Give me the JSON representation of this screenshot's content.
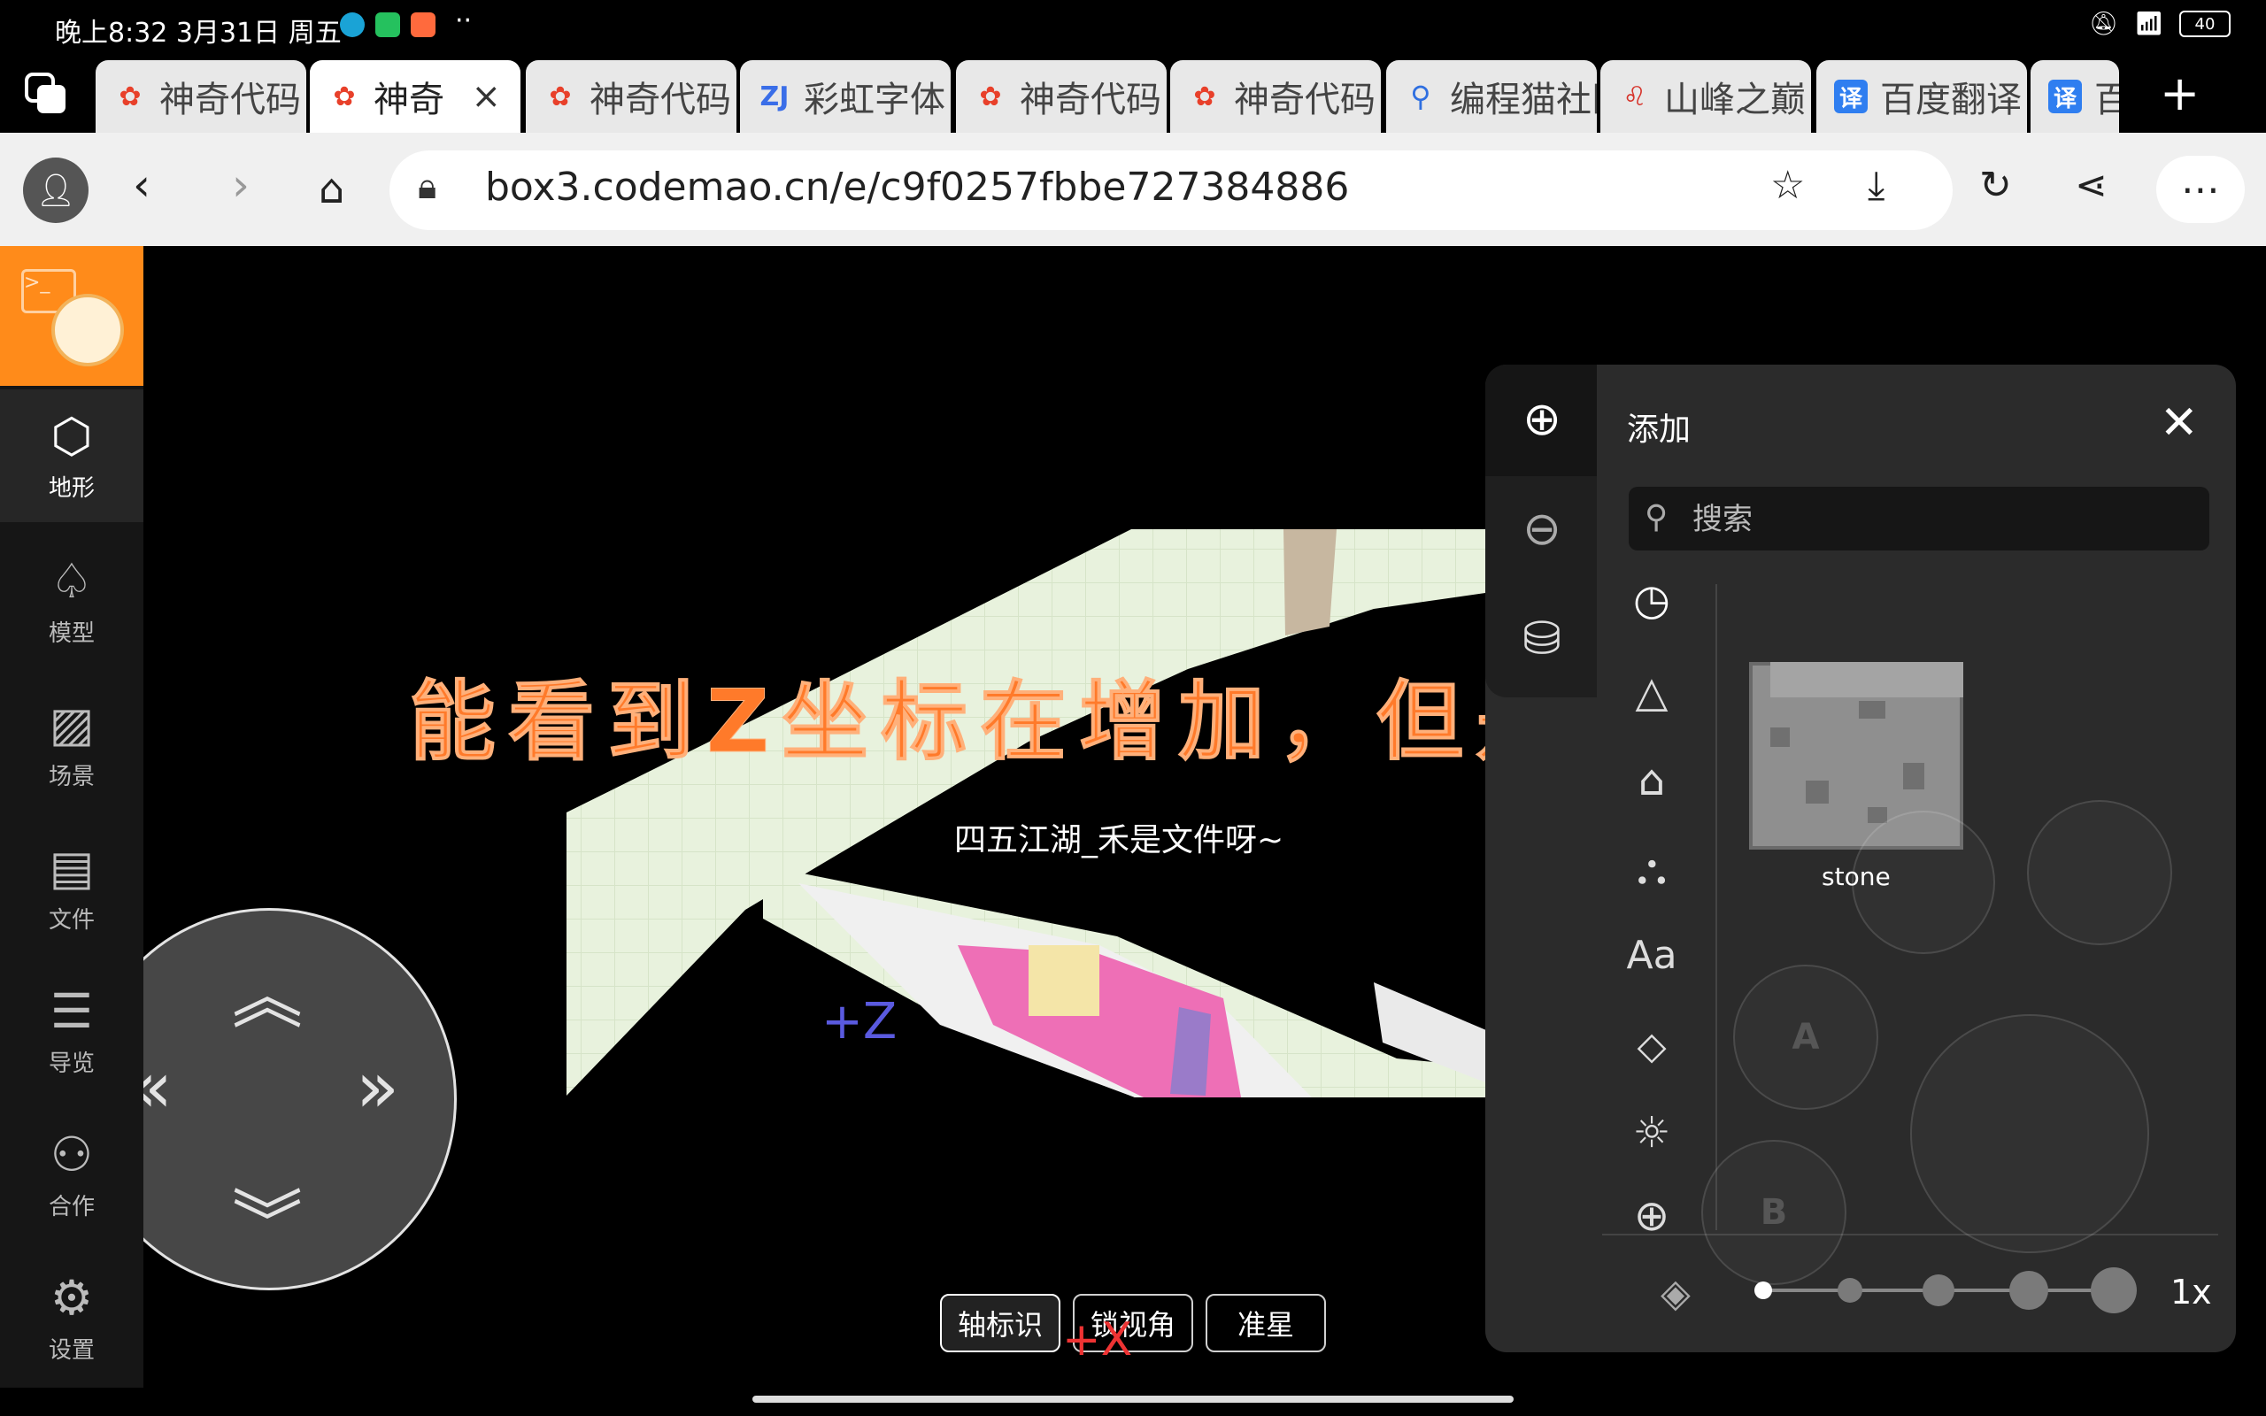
{
  "status": {
    "time": "晚上8:32 3月31日 周五",
    "battery": "40",
    "more": "··"
  },
  "tabs": [
    {
      "label": "神奇代码",
      "icon": "huawei-flower-icon",
      "active": false
    },
    {
      "label": "神奇",
      "icon": "huawei-flower-icon",
      "active": true
    },
    {
      "label": "神奇代码",
      "icon": "huawei-flower-icon",
      "active": false
    },
    {
      "label": "彩虹字体",
      "icon": "zj-icon",
      "active": false
    },
    {
      "label": "神奇代码",
      "icon": "huawei-flower-icon",
      "active": false
    },
    {
      "label": "神奇代码",
      "icon": "huawei-flower-icon",
      "active": false
    },
    {
      "label": "编程猫社区",
      "icon": "search-icon",
      "active": false
    },
    {
      "label": "山峰之巅",
      "icon": "lion-icon",
      "active": false
    },
    {
      "label": "百度翻译",
      "icon": "translate-icon",
      "active": false
    },
    {
      "label": "百",
      "icon": "translate-icon",
      "active": false
    }
  ],
  "tab_close": "×",
  "new_tab": "+",
  "address": {
    "url": "box3.codemao.cn/e/c9f0257fbbe727384886"
  },
  "sidebar": {
    "items": [
      {
        "label": "地形",
        "icon": "cube-icon",
        "glyph": "⬡"
      },
      {
        "label": "模型",
        "icon": "tree-icon",
        "glyph": "♤"
      },
      {
        "label": "场景",
        "icon": "image-icon",
        "glyph": "▨"
      },
      {
        "label": "文件",
        "icon": "folder-icon",
        "glyph": "▤"
      },
      {
        "label": "导览",
        "icon": "list-icon",
        "glyph": "☰"
      },
      {
        "label": "合作",
        "icon": "users-icon",
        "glyph": "⚇"
      },
      {
        "label": "设置",
        "icon": "gear-icon",
        "glyph": "⚙"
      }
    ]
  },
  "scene": {
    "annotation": "能看到Z坐标在增加，但是没有动画",
    "player_name": "四五江湖_禾是文件呀~",
    "axis_z": "+Z",
    "axis_x": "+X"
  },
  "bottom_buttons": {
    "axis": "轴标识",
    "lock_view": "锁视角",
    "crosshair": "准星"
  },
  "panel": {
    "title": "添加",
    "close": "✕",
    "search_placeholder": "搜索",
    "item_name": "stone",
    "ghost_a": "A",
    "ghost_b": "B",
    "zoom": "1x",
    "category_text_icon": "Aa"
  },
  "colors": {
    "accent_orange": "#ff8b1a",
    "annotation": "#ff7a2a",
    "axis_z": "#5a5adf",
    "axis_x": "#ee3333"
  }
}
